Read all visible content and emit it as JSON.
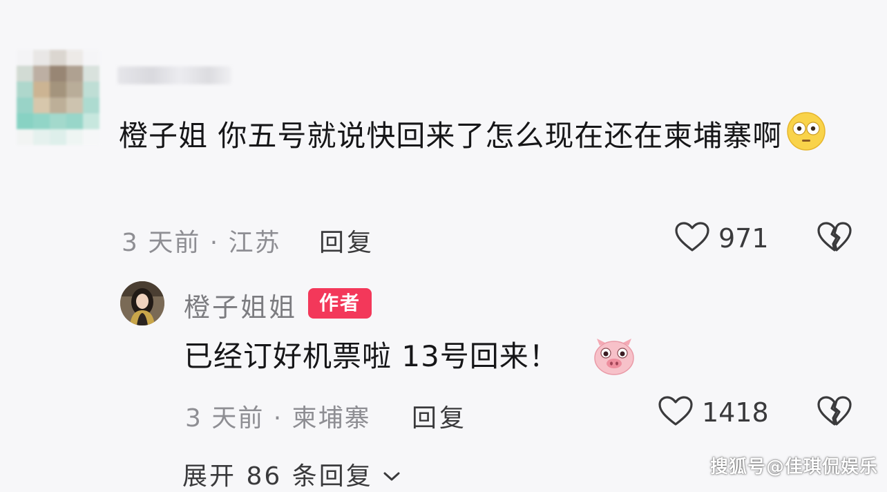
{
  "comment": {
    "text": "橙子姐 你五号就说快回来了怎么现在还在柬埔寨啊",
    "emoji_icon": "flushed-face-emoji",
    "time_location": "3 天前 · 江苏",
    "reply_label": "回复",
    "like_count": "971"
  },
  "author_reply": {
    "name": "橙子姐姐",
    "badge": "作者",
    "text": "已经订好机票啦 13号回来！",
    "emoji_icon": "pig-face-emoji",
    "time_location": "3 天前 · 柬埔寨",
    "reply_label": "回复",
    "like_count": "1418"
  },
  "expand_label": "展开 86 条回复",
  "watermark": "搜狐号@佳琪侃娱乐",
  "colors": {
    "badge": "#f3385a",
    "meta_text": "#8e8e93",
    "background": "#f7f7f9"
  }
}
